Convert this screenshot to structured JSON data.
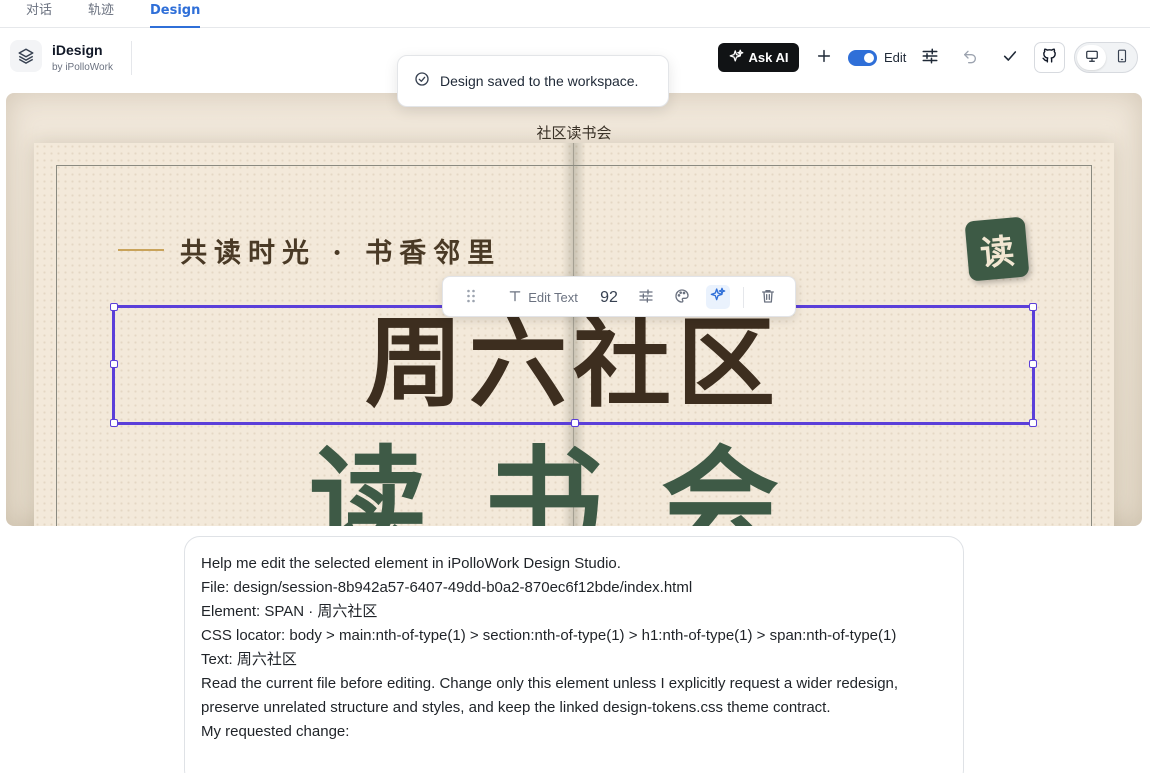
{
  "tabs": [
    {
      "label": "对话"
    },
    {
      "label": "轨迹"
    },
    {
      "label": "Design"
    }
  ],
  "brand": {
    "title": "iDesign",
    "subtitle": "by iPolloWork"
  },
  "toast": {
    "message": "Design saved to the workspace."
  },
  "toolbar": {
    "ask_ai_label": "Ask AI",
    "edit_label": "Edit",
    "edit_enabled": true,
    "device_selected": "desktop"
  },
  "canvas": {
    "page_label": "社区读书会",
    "tagline": "共读时光 · 书香邻里",
    "badge_char": "读",
    "headline": "周六社区",
    "subhead": "读书会"
  },
  "float_toolbar": {
    "edit_text_label": "Edit Text",
    "font_size": "92"
  },
  "prompt": {
    "lines": [
      "Help me edit the selected element in iPolloWork Design Studio.",
      "File: design/session-8b942a57-6407-49dd-b0a2-870ec6f12bde/index.html",
      "Element: SPAN · 周六社区",
      "CSS locator: body > main:nth-of-type(1) > section:nth-of-type(1) > h1:nth-of-type(1) > span:nth-of-type(1)",
      "Text: 周六社区",
      "Read the current file before editing. Change only this element unless I explicitly request a wider redesign, preserve unrelated structure and styles, and keep the linked design-tokens.css theme contract.",
      "My requested change:"
    ]
  },
  "colors": {
    "accent": "#2f6fd8",
    "selection": "#5b3fd9",
    "headline": "#3d2e1f",
    "subhead": "#3e5a46",
    "badge": "#3d5a45"
  }
}
